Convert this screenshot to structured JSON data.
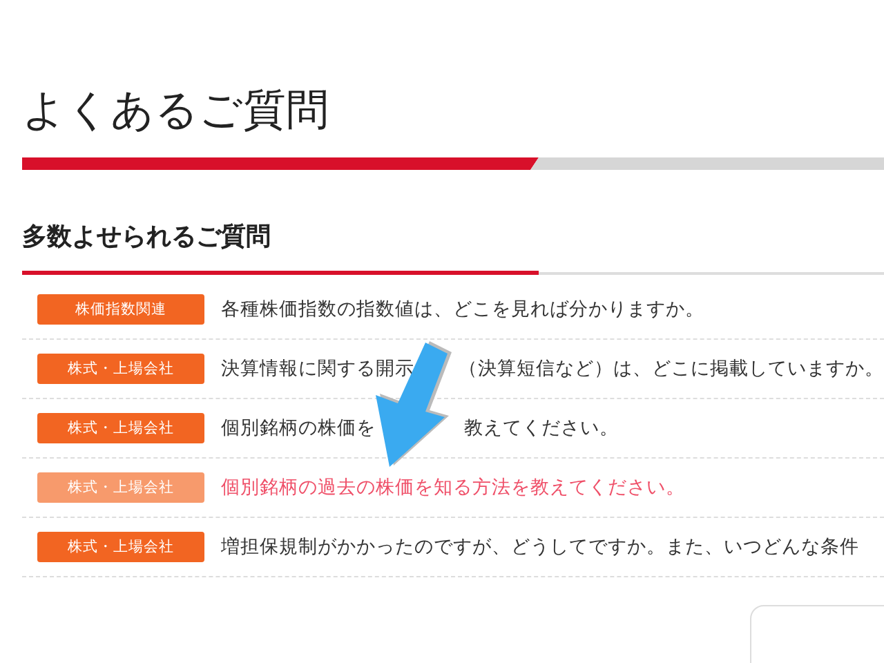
{
  "page_title": "よくあるご質問",
  "section": {
    "heading": "多数よせられるご質問",
    "questions": [
      {
        "category": "株価指数関連",
        "parts": [
          "各種株価指数の指数値は、どこを見れば分かりますか。"
        ],
        "highlighted": false
      },
      {
        "category": "株式・上場会社",
        "parts": [
          "決算情報に関する開示",
          "（決算短信など）は、どこに掲載していますか。"
        ],
        "highlighted": false
      },
      {
        "category": "株式・上場会社",
        "parts": [
          "個別銘柄の株価を",
          "教えてください。"
        ],
        "highlighted": false
      },
      {
        "category": "株式・上場会社",
        "parts": [
          "個別銘柄の過去の株価を知る方法を教えてください。"
        ],
        "highlighted": true
      },
      {
        "category": "株式・上場会社",
        "parts": [
          "増担保規制がかかったのですが、どうしてですか。また、いつどんな条件"
        ],
        "highlighted": false
      }
    ]
  }
}
